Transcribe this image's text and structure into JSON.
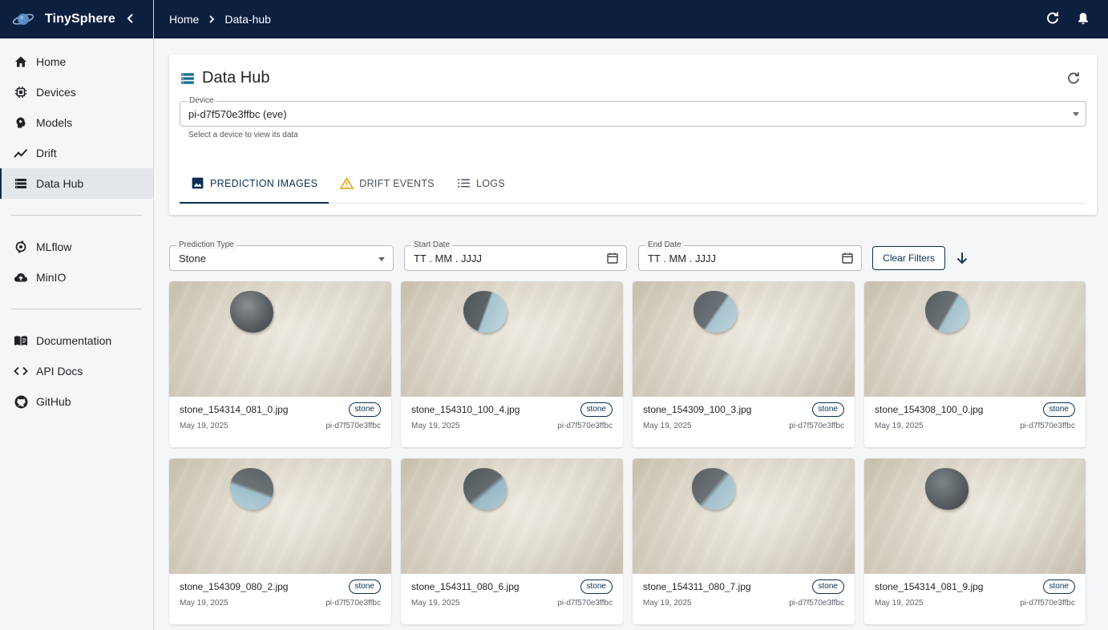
{
  "app": {
    "name": "TinySphere"
  },
  "breadcrumb": [
    "Home",
    "Data-hub"
  ],
  "sidebar": {
    "primary": [
      {
        "label": "Home",
        "icon": "home-icon"
      },
      {
        "label": "Devices",
        "icon": "chip-icon"
      },
      {
        "label": "Models",
        "icon": "head-icon"
      },
      {
        "label": "Drift",
        "icon": "trend-icon"
      },
      {
        "label": "Data Hub",
        "icon": "storage-icon",
        "active": true
      }
    ],
    "tools": [
      {
        "label": "MLflow",
        "icon": "mlflow-icon"
      },
      {
        "label": "MinIO",
        "icon": "cloud-upload-icon"
      }
    ],
    "links": [
      {
        "label": "Documentation",
        "icon": "book-icon"
      },
      {
        "label": "API Docs",
        "icon": "code-icon"
      },
      {
        "label": "GitHub",
        "icon": "github-icon"
      }
    ]
  },
  "page": {
    "title": "Data Hub",
    "device": {
      "label": "Device",
      "value": "pi-d7f570e3ffbc (eve)",
      "helper": "Select a device to view its data"
    },
    "tabs": [
      {
        "label": "PREDICTION IMAGES",
        "icon": "image-icon",
        "active": true
      },
      {
        "label": "DRIFT EVENTS",
        "icon": "warning-icon",
        "active": false
      },
      {
        "label": "LOGS",
        "icon": "list-icon",
        "active": false
      }
    ]
  },
  "filters": {
    "prediction_type": {
      "label": "Prediction Type",
      "value": "Stone"
    },
    "start_date": {
      "label": "Start Date",
      "value": "TT . MM . JJJJ"
    },
    "end_date": {
      "label": "End Date",
      "value": "TT . MM . JJJJ"
    },
    "clear_label": "Clear Filters"
  },
  "images": [
    {
      "filename": "stone_154314_081_0.jpg",
      "tag": "stone",
      "date": "May 19, 2025",
      "device": "pi-d7f570e3ffbc"
    },
    {
      "filename": "stone_154310_100_4.jpg",
      "tag": "stone",
      "date": "May 19, 2025",
      "device": "pi-d7f570e3ffbc"
    },
    {
      "filename": "stone_154309_100_3.jpg",
      "tag": "stone",
      "date": "May 19, 2025",
      "device": "pi-d7f570e3ffbc"
    },
    {
      "filename": "stone_154308_100_0.jpg",
      "tag": "stone",
      "date": "May 19, 2025",
      "device": "pi-d7f570e3ffbc"
    },
    {
      "filename": "stone_154309_080_2.jpg",
      "tag": "stone",
      "date": "May 19, 2025",
      "device": "pi-d7f570e3ffbc"
    },
    {
      "filename": "stone_154311_080_6.jpg",
      "tag": "stone",
      "date": "May 19, 2025",
      "device": "pi-d7f570e3ffbc"
    },
    {
      "filename": "stone_154311_080_7.jpg",
      "tag": "stone",
      "date": "May 19, 2025",
      "device": "pi-d7f570e3ffbc"
    },
    {
      "filename": "stone_154314_081_9.jpg",
      "tag": "stone",
      "date": "May 19, 2025",
      "device": "pi-d7f570e3ffbc"
    }
  ],
  "colors": {
    "nav_bg": "#0b1f3f",
    "accent": "#0b2e52",
    "warning": "#e0a100",
    "page_bg": "#f4f6f8"
  }
}
